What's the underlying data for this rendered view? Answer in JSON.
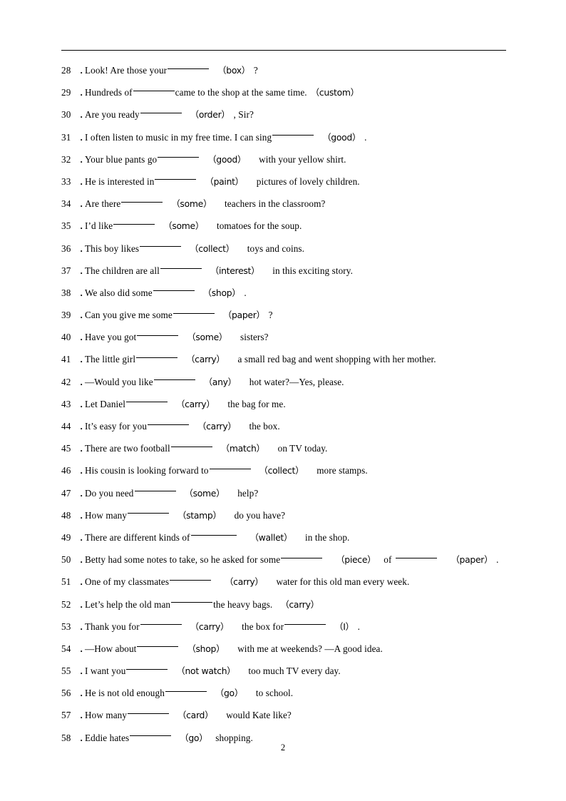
{
  "document": {
    "page_number": "2",
    "number_separator": "．",
    "open_paren": "（",
    "close_paren": "）",
    "header_rule": true
  },
  "exercises": [
    {
      "number": "28",
      "parts": [
        {
          "type": "text",
          "value": "Look! Are those your"
        },
        {
          "type": "blank",
          "size": "md"
        },
        {
          "type": "gap",
          "size": "md"
        },
        {
          "type": "cue",
          "value": "box"
        },
        {
          "type": "gap",
          "size": "sm"
        },
        {
          "type": "text",
          "value": "?"
        }
      ]
    },
    {
      "number": "29",
      "parts": [
        {
          "type": "text",
          "value": "Hundreds of"
        },
        {
          "type": "blank",
          "size": "md"
        },
        {
          "type": "text",
          "value": "came to the shop at the same time."
        },
        {
          "type": "gap",
          "size": "sm"
        },
        {
          "type": "cue",
          "value": "custom"
        }
      ]
    },
    {
      "number": "30",
      "parts": [
        {
          "type": "text",
          "value": "Are you ready"
        },
        {
          "type": "blank",
          "size": "md"
        },
        {
          "type": "gap",
          "size": "md"
        },
        {
          "type": "cue",
          "value": "order"
        },
        {
          "type": "gap",
          "size": "sm"
        },
        {
          "type": "text",
          "value": ", Sir?"
        }
      ]
    },
    {
      "number": "31",
      "parts": [
        {
          "type": "text",
          "value": "I often listen to music in my free time. I can sing"
        },
        {
          "type": "blank",
          "size": "md"
        },
        {
          "type": "gap",
          "size": "md"
        },
        {
          "type": "cue",
          "value": "good"
        },
        {
          "type": "gap",
          "size": "sm"
        },
        {
          "type": "text",
          "value": "."
        }
      ]
    },
    {
      "number": "32",
      "parts": [
        {
          "type": "text",
          "value": "Your blue pants go"
        },
        {
          "type": "blank",
          "size": "md"
        },
        {
          "type": "gap",
          "size": "md"
        },
        {
          "type": "cue",
          "value": "good"
        },
        {
          "type": "gap",
          "size": "lg"
        },
        {
          "type": "text",
          "value": "with your yellow shirt."
        }
      ]
    },
    {
      "number": "33",
      "parts": [
        {
          "type": "text",
          "value": "He is interested in"
        },
        {
          "type": "blank",
          "size": "md"
        },
        {
          "type": "gap",
          "size": "md"
        },
        {
          "type": "cue",
          "value": "paint"
        },
        {
          "type": "gap",
          "size": "lg"
        },
        {
          "type": "text",
          "value": "pictures of lovely children."
        }
      ]
    },
    {
      "number": "34",
      "parts": [
        {
          "type": "text",
          "value": "Are there"
        },
        {
          "type": "blank",
          "size": "md"
        },
        {
          "type": "gap",
          "size": "md"
        },
        {
          "type": "cue",
          "value": "some"
        },
        {
          "type": "gap",
          "size": "lg"
        },
        {
          "type": "text",
          "value": "teachers in the classroom?"
        }
      ]
    },
    {
      "number": "35",
      "parts": [
        {
          "type": "text",
          "value": "I’d like"
        },
        {
          "type": "blank",
          "size": "md"
        },
        {
          "type": "gap",
          "size": "md"
        },
        {
          "type": "cue",
          "value": "some"
        },
        {
          "type": "gap",
          "size": "lg"
        },
        {
          "type": "text",
          "value": "tomatoes for the soup."
        }
      ]
    },
    {
      "number": "36",
      "parts": [
        {
          "type": "text",
          "value": "This boy likes"
        },
        {
          "type": "blank",
          "size": "md"
        },
        {
          "type": "gap",
          "size": "md"
        },
        {
          "type": "cue",
          "value": "collect"
        },
        {
          "type": "gap",
          "size": "lg"
        },
        {
          "type": "text",
          "value": "toys and coins."
        }
      ]
    },
    {
      "number": "37",
      "parts": [
        {
          "type": "text",
          "value": "The children are all"
        },
        {
          "type": "blank",
          "size": "md"
        },
        {
          "type": "gap",
          "size": "md"
        },
        {
          "type": "cue",
          "value": "interest"
        },
        {
          "type": "gap",
          "size": "lg"
        },
        {
          "type": "text",
          "value": "in this exciting story."
        }
      ]
    },
    {
      "number": "38",
      "parts": [
        {
          "type": "text",
          "value": "We also did some"
        },
        {
          "type": "blank",
          "size": "md"
        },
        {
          "type": "gap",
          "size": "md"
        },
        {
          "type": "cue",
          "value": "shop"
        },
        {
          "type": "gap",
          "size": "sm"
        },
        {
          "type": "text",
          "value": "."
        }
      ]
    },
    {
      "number": "39",
      "parts": [
        {
          "type": "text",
          "value": "Can you give me some"
        },
        {
          "type": "blank",
          "size": "md"
        },
        {
          "type": "gap",
          "size": "md"
        },
        {
          "type": "cue",
          "value": "paper"
        },
        {
          "type": "gap",
          "size": "sm"
        },
        {
          "type": "text",
          "value": "?"
        }
      ]
    },
    {
      "number": "40",
      "parts": [
        {
          "type": "text",
          "value": "Have you got"
        },
        {
          "type": "blank",
          "size": "md"
        },
        {
          "type": "gap",
          "size": "md"
        },
        {
          "type": "cue",
          "value": "some"
        },
        {
          "type": "gap",
          "size": "lg"
        },
        {
          "type": "text",
          "value": "sisters?"
        }
      ]
    },
    {
      "number": "41",
      "parts": [
        {
          "type": "text",
          "value": "The little girl"
        },
        {
          "type": "blank",
          "size": "md"
        },
        {
          "type": "gap",
          "size": "md"
        },
        {
          "type": "cue",
          "value": "carry"
        },
        {
          "type": "gap",
          "size": "lg"
        },
        {
          "type": "text",
          "value": "a small red bag and went shopping with her mother."
        }
      ]
    },
    {
      "number": "42",
      "parts": [
        {
          "type": "text",
          "value": "—Would you like"
        },
        {
          "type": "blank",
          "size": "md"
        },
        {
          "type": "gap",
          "size": "md"
        },
        {
          "type": "cue",
          "value": "any"
        },
        {
          "type": "gap",
          "size": "lg"
        },
        {
          "type": "text",
          "value": "hot water?—Yes, please."
        }
      ]
    },
    {
      "number": "43",
      "parts": [
        {
          "type": "text",
          "value": "Let Daniel"
        },
        {
          "type": "blank",
          "size": "md"
        },
        {
          "type": "gap",
          "size": "md"
        },
        {
          "type": "cue",
          "value": "carry"
        },
        {
          "type": "gap",
          "size": "lg"
        },
        {
          "type": "text",
          "value": "the bag for me."
        }
      ]
    },
    {
      "number": "44",
      "parts": [
        {
          "type": "text",
          "value": "It’s easy for you"
        },
        {
          "type": "blank",
          "size": "md"
        },
        {
          "type": "gap",
          "size": "md"
        },
        {
          "type": "cue",
          "value": "carry"
        },
        {
          "type": "gap",
          "size": "lg"
        },
        {
          "type": "text",
          "value": "the box."
        }
      ]
    },
    {
      "number": "45",
      "parts": [
        {
          "type": "text",
          "value": "There are two football"
        },
        {
          "type": "blank",
          "size": "md"
        },
        {
          "type": "gap",
          "size": "md"
        },
        {
          "type": "cue",
          "value": "match"
        },
        {
          "type": "gap",
          "size": "lg"
        },
        {
          "type": "text",
          "value": "on TV today."
        }
      ]
    },
    {
      "number": "46",
      "parts": [
        {
          "type": "text",
          "value": "His cousin is looking forward to"
        },
        {
          "type": "blank",
          "size": "md"
        },
        {
          "type": "gap",
          "size": "md"
        },
        {
          "type": "cue",
          "value": "collect"
        },
        {
          "type": "gap",
          "size": "lg"
        },
        {
          "type": "text",
          "value": "more stamps."
        }
      ]
    },
    {
      "number": "47",
      "parts": [
        {
          "type": "text",
          "value": "Do you need"
        },
        {
          "type": "blank",
          "size": "md"
        },
        {
          "type": "gap",
          "size": "md"
        },
        {
          "type": "cue",
          "value": "some"
        },
        {
          "type": "gap",
          "size": "lg"
        },
        {
          "type": "text",
          "value": "help?"
        }
      ]
    },
    {
      "number": "48",
      "parts": [
        {
          "type": "text",
          "value": "How many"
        },
        {
          "type": "blank",
          "size": "md"
        },
        {
          "type": "gap",
          "size": "md"
        },
        {
          "type": "cue",
          "value": "stamp"
        },
        {
          "type": "gap",
          "size": "lg"
        },
        {
          "type": "text",
          "value": "do you have?"
        }
      ]
    },
    {
      "number": "49",
      "parts": [
        {
          "type": "text",
          "value": "There are different kinds of"
        },
        {
          "type": "blank",
          "size": "lg"
        },
        {
          "type": "gap",
          "size": "lg"
        },
        {
          "type": "cue",
          "value": "wallet"
        },
        {
          "type": "gap",
          "size": "lg"
        },
        {
          "type": "text",
          "value": "in the shop."
        }
      ]
    },
    {
      "number": "50",
      "parts": [
        {
          "type": "text",
          "value": "Betty had some notes to take, so he asked for some"
        },
        {
          "type": "blank",
          "size": "md"
        },
        {
          "type": "gap",
          "size": "lg"
        },
        {
          "type": "cue",
          "value": "piece"
        },
        {
          "type": "gap",
          "size": "md"
        },
        {
          "type": "text",
          "value": "of"
        },
        {
          "type": "gap",
          "size": "sm"
        },
        {
          "type": "blank",
          "size": "md"
        },
        {
          "type": "gap",
          "size": "lg"
        },
        {
          "type": "cue",
          "value": "paper"
        },
        {
          "type": "gap",
          "size": "sm"
        },
        {
          "type": "text",
          "value": "."
        }
      ]
    },
    {
      "number": "51",
      "parts": [
        {
          "type": "text",
          "value": "One of my classmates"
        },
        {
          "type": "blank",
          "size": "md"
        },
        {
          "type": "gap",
          "size": "lg"
        },
        {
          "type": "cue",
          "value": "carry"
        },
        {
          "type": "gap",
          "size": "lg"
        },
        {
          "type": "text",
          "value": "water for this old man every week."
        }
      ]
    },
    {
      "number": "52",
      "parts": [
        {
          "type": "text",
          "value": "Let’s help the old man"
        },
        {
          "type": "blank",
          "size": "md"
        },
        {
          "type": "text",
          "value": "the heavy bags."
        },
        {
          "type": "gap",
          "size": "md"
        },
        {
          "type": "cue",
          "value": "carry"
        }
      ]
    },
    {
      "number": "53",
      "parts": [
        {
          "type": "text",
          "value": "Thank you for"
        },
        {
          "type": "blank",
          "size": "md"
        },
        {
          "type": "gap",
          "size": "md"
        },
        {
          "type": "cue",
          "value": "carry"
        },
        {
          "type": "gap",
          "size": "lg"
        },
        {
          "type": "text",
          "value": "the box for"
        },
        {
          "type": "blank",
          "size": "md"
        },
        {
          "type": "gap",
          "size": "md"
        },
        {
          "type": "cue",
          "value": "I"
        },
        {
          "type": "gap",
          "size": "sm"
        },
        {
          "type": "text",
          "value": "."
        }
      ]
    },
    {
      "number": "54",
      "parts": [
        {
          "type": "text",
          "value": "—How about"
        },
        {
          "type": "blank",
          "size": "md"
        },
        {
          "type": "gap",
          "size": "md"
        },
        {
          "type": "cue",
          "value": "shop"
        },
        {
          "type": "gap",
          "size": "lg"
        },
        {
          "type": "text",
          "value": "with me at weekends? —A good idea."
        }
      ]
    },
    {
      "number": "55",
      "parts": [
        {
          "type": "text",
          "value": "I want you"
        },
        {
          "type": "blank",
          "size": "md"
        },
        {
          "type": "gap",
          "size": "md"
        },
        {
          "type": "cue",
          "value": "not watch"
        },
        {
          "type": "gap",
          "size": "lg"
        },
        {
          "type": "text",
          "value": "too much TV every day."
        }
      ]
    },
    {
      "number": "56",
      "parts": [
        {
          "type": "text",
          "value": "He is not old enough"
        },
        {
          "type": "blank",
          "size": "md"
        },
        {
          "type": "gap",
          "size": "md"
        },
        {
          "type": "cue",
          "value": "go"
        },
        {
          "type": "gap",
          "size": "lg"
        },
        {
          "type": "text",
          "value": "to school."
        }
      ]
    },
    {
      "number": "57",
      "parts": [
        {
          "type": "text",
          "value": "How many"
        },
        {
          "type": "blank",
          "size": "md"
        },
        {
          "type": "gap",
          "size": "md"
        },
        {
          "type": "cue",
          "value": "card"
        },
        {
          "type": "gap",
          "size": "lg"
        },
        {
          "type": "text",
          "value": "would Kate like?"
        }
      ]
    },
    {
      "number": "58",
      "parts": [
        {
          "type": "text",
          "value": "Eddie hates"
        },
        {
          "type": "blank",
          "size": "md"
        },
        {
          "type": "gap",
          "size": "md"
        },
        {
          "type": "cue",
          "value": "go"
        },
        {
          "type": "gap",
          "size": "md"
        },
        {
          "type": "text",
          "value": "shopping."
        }
      ]
    }
  ]
}
